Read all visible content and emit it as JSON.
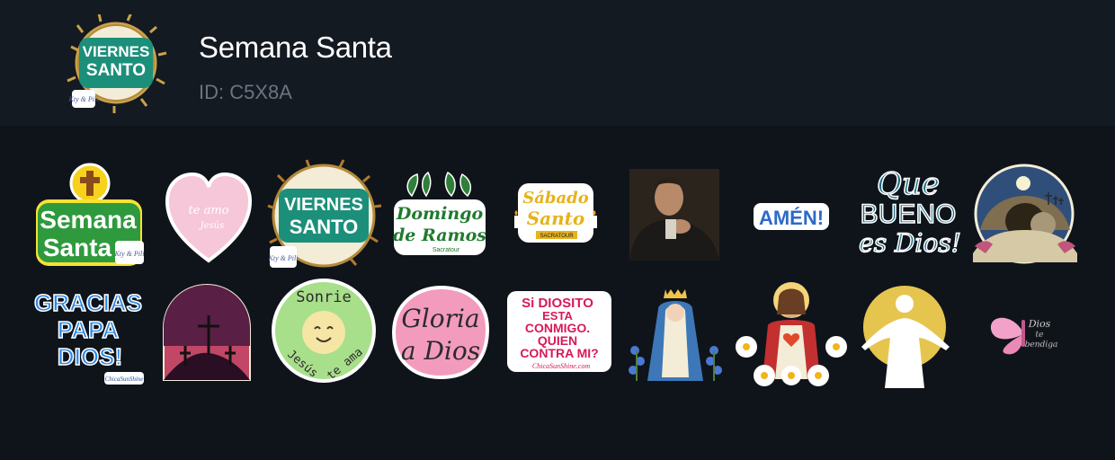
{
  "pack": {
    "title": "Semana Santa",
    "id_text": "ID: C5X8A",
    "icon": "viernes-santo-crown-of-thorns"
  },
  "stickers": [
    {
      "name": "sticker-semana-santa",
      "lines": [
        "Semana",
        "Santa"
      ],
      "tag": "Kty & Pili"
    },
    {
      "name": "sticker-te-amo-jesus",
      "lines": [
        "te amo",
        "Jesús"
      ]
    },
    {
      "name": "sticker-viernes-santo",
      "lines": [
        "VIERNES",
        "SANTO"
      ],
      "tag": "Kty & Pili"
    },
    {
      "name": "sticker-domingo-de-ramos",
      "lines": [
        "Domingo",
        "de Ramos"
      ],
      "tag": "Sacratour"
    },
    {
      "name": "sticker-sabado-santo",
      "lines": [
        "Sábado",
        "Santo"
      ],
      "tag": "SACRATOUR"
    },
    {
      "name": "sticker-praying-man"
    },
    {
      "name": "sticker-amen",
      "lines": [
        "AMÉN!"
      ]
    },
    {
      "name": "sticker-que-bueno-es-dios",
      "lines": [
        "Que",
        "BUENO",
        "es Dios!"
      ]
    },
    {
      "name": "sticker-empty-tomb"
    },
    {
      "name": "sticker-gracias-papa-dios",
      "lines": [
        "GRACIAS",
        "PAPA",
        "DIOS!"
      ],
      "tag": "ChicaSunShine"
    },
    {
      "name": "sticker-crucifixion-arch"
    },
    {
      "name": "sticker-sonrie-jesus-te-ama",
      "lines": [
        "Sonrie",
        "Jesús",
        "te ama"
      ]
    },
    {
      "name": "sticker-gloria-a-dios",
      "lines": [
        "Gloria",
        "a Dios"
      ]
    },
    {
      "name": "sticker-si-diosito-esta-conmigo",
      "lines": [
        "Si DIOSITO",
        "ESTA",
        "CONMIGO.",
        "QUIEN",
        "CONTRA MI?"
      ],
      "tag": "ChicaSunShine.com"
    },
    {
      "name": "sticker-virgin-mary"
    },
    {
      "name": "sticker-sacred-heart-jesus"
    },
    {
      "name": "sticker-jesus-silhouette"
    },
    {
      "name": "sticker-dios-te-bendiga",
      "lines": [
        "Dios",
        "te",
        "bendiga"
      ]
    }
  ]
}
